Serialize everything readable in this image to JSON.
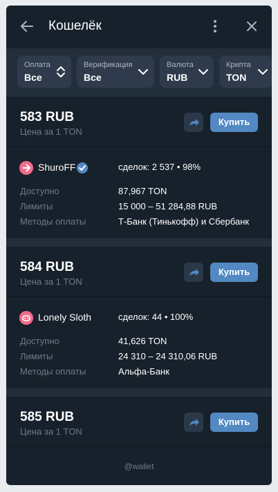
{
  "header": {
    "title": "Кошелёк"
  },
  "filters": [
    {
      "label": "Оплата",
      "value": "Все",
      "icon": "updown-icon"
    },
    {
      "label": "Верификация",
      "value": "Все",
      "icon": "chevron-down-icon"
    },
    {
      "label": "Валюта",
      "value": "RUB",
      "icon": "chevron-down-icon"
    },
    {
      "label": "Крипта",
      "value": "TON",
      "icon": "chevron-down-icon"
    }
  ],
  "offers": [
    {
      "price": "583 RUB",
      "per": "Цена за 1 TON",
      "buy": "Купить",
      "seller": "ShuroFF",
      "verified": true,
      "deals": "сделок: 2 537 • 98%",
      "available_label": "Доступно",
      "available": "87,967 TON",
      "limits_label": "Лимиты",
      "limits": "15 000 – 51 284,88 RUB",
      "methods_label": "Методы оплаты",
      "methods": "Т-Банк (Тинькофф) и Сбербанк"
    },
    {
      "price": "584 RUB",
      "per": "Цена за 1 TON",
      "buy": "Купить",
      "seller": "Lonely Sloth",
      "verified": false,
      "deals": "сделок: 44 • 100%",
      "available_label": "Доступно",
      "available": "41,626 TON",
      "limits_label": "Лимиты",
      "limits": "24 310 – 24 310,06 RUB",
      "methods_label": "Методы оплаты",
      "methods": "Альфа-Банк"
    },
    {
      "price": "585 RUB",
      "per": "Цена за 1 TON",
      "buy": "Купить"
    }
  ],
  "footer": "@wallet",
  "colors": {
    "accent": "#5289c2",
    "background": "#17212b",
    "panel": "#232e3c"
  }
}
